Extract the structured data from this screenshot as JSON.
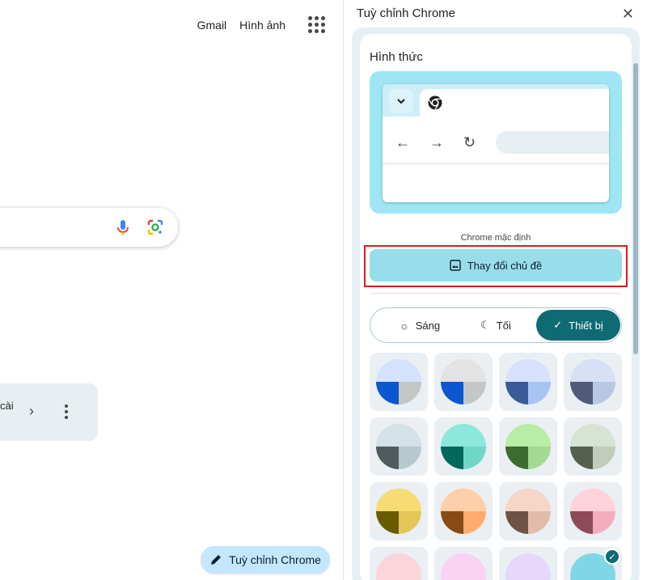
{
  "ntp": {
    "gmail": "Gmail",
    "images": "Hình ảnh",
    "card_text": "cài",
    "customize_button": "Tuỳ chỉnh Chrome"
  },
  "panel": {
    "title": "Tuỳ chỉnh Chrome",
    "section_title": "Hình thức",
    "default_label": "Chrome mặc định",
    "change_theme": "Thay đổi chủ đề",
    "modes": [
      {
        "label": "Sáng",
        "icon": "sun-icon",
        "selected": false
      },
      {
        "label": "Tối",
        "icon": "moon-icon",
        "selected": false
      },
      {
        "label": "Thiết bị",
        "icon": "check-icon",
        "selected": true
      }
    ],
    "swatches": [
      {
        "top": "#d3e3fd",
        "bl": "#0b57d0",
        "br": "#c4c7c5"
      },
      {
        "top": "#e3e3e3",
        "bl": "#0b57d0",
        "br": "#c4c7c5"
      },
      {
        "top": "#d6e2fb",
        "bl": "#3b5a99",
        "br": "#a8c4f5"
      },
      {
        "top": "#d7e0f5",
        "bl": "#4f5b78",
        "br": "#b9c6e4"
      },
      {
        "top": "#d3e2e7",
        "bl": "#4f5b5e",
        "br": "#b7c9ce"
      },
      {
        "top": "#8ce8dc",
        "bl": "#00695c",
        "br": "#70d6c8"
      },
      {
        "top": "#b8eda6",
        "bl": "#3e6b30",
        "br": "#a3d993"
      },
      {
        "top": "#d8e4d3",
        "bl": "#56604f",
        "br": "#c1ccbc"
      },
      {
        "top": "#f6dc72",
        "bl": "#6a5a00",
        "br": "#e4c658"
      },
      {
        "top": "#ffcfaa",
        "bl": "#8a4a14",
        "br": "#ffac6e"
      },
      {
        "top": "#f6d6c6",
        "bl": "#6e5345",
        "br": "#e2bcaa"
      },
      {
        "top": "#ffd2dc",
        "bl": "#8e4a5a",
        "br": "#f3aebe"
      },
      {
        "top": "#fbd5dc",
        "bl": "#fbd5dc",
        "br": "#fbd5dc"
      },
      {
        "top": "#f9d3f1",
        "bl": "#f9d3f1",
        "br": "#f9d3f1"
      },
      {
        "top": "#e6d7fb",
        "bl": "#e6d7fb",
        "br": "#e6d7fb"
      },
      {
        "top": "#7fd7e6",
        "bl": "#7fd7e6",
        "br": "#7fd7e6"
      }
    ],
    "selected_swatch": 15
  },
  "colors": {
    "accent": "#0e6b74",
    "panel_bg": "#e6f0f4",
    "customize_button_bg": "#c2e7ff",
    "change_theme_bg": "#98deea",
    "highlight": "#e11818"
  }
}
